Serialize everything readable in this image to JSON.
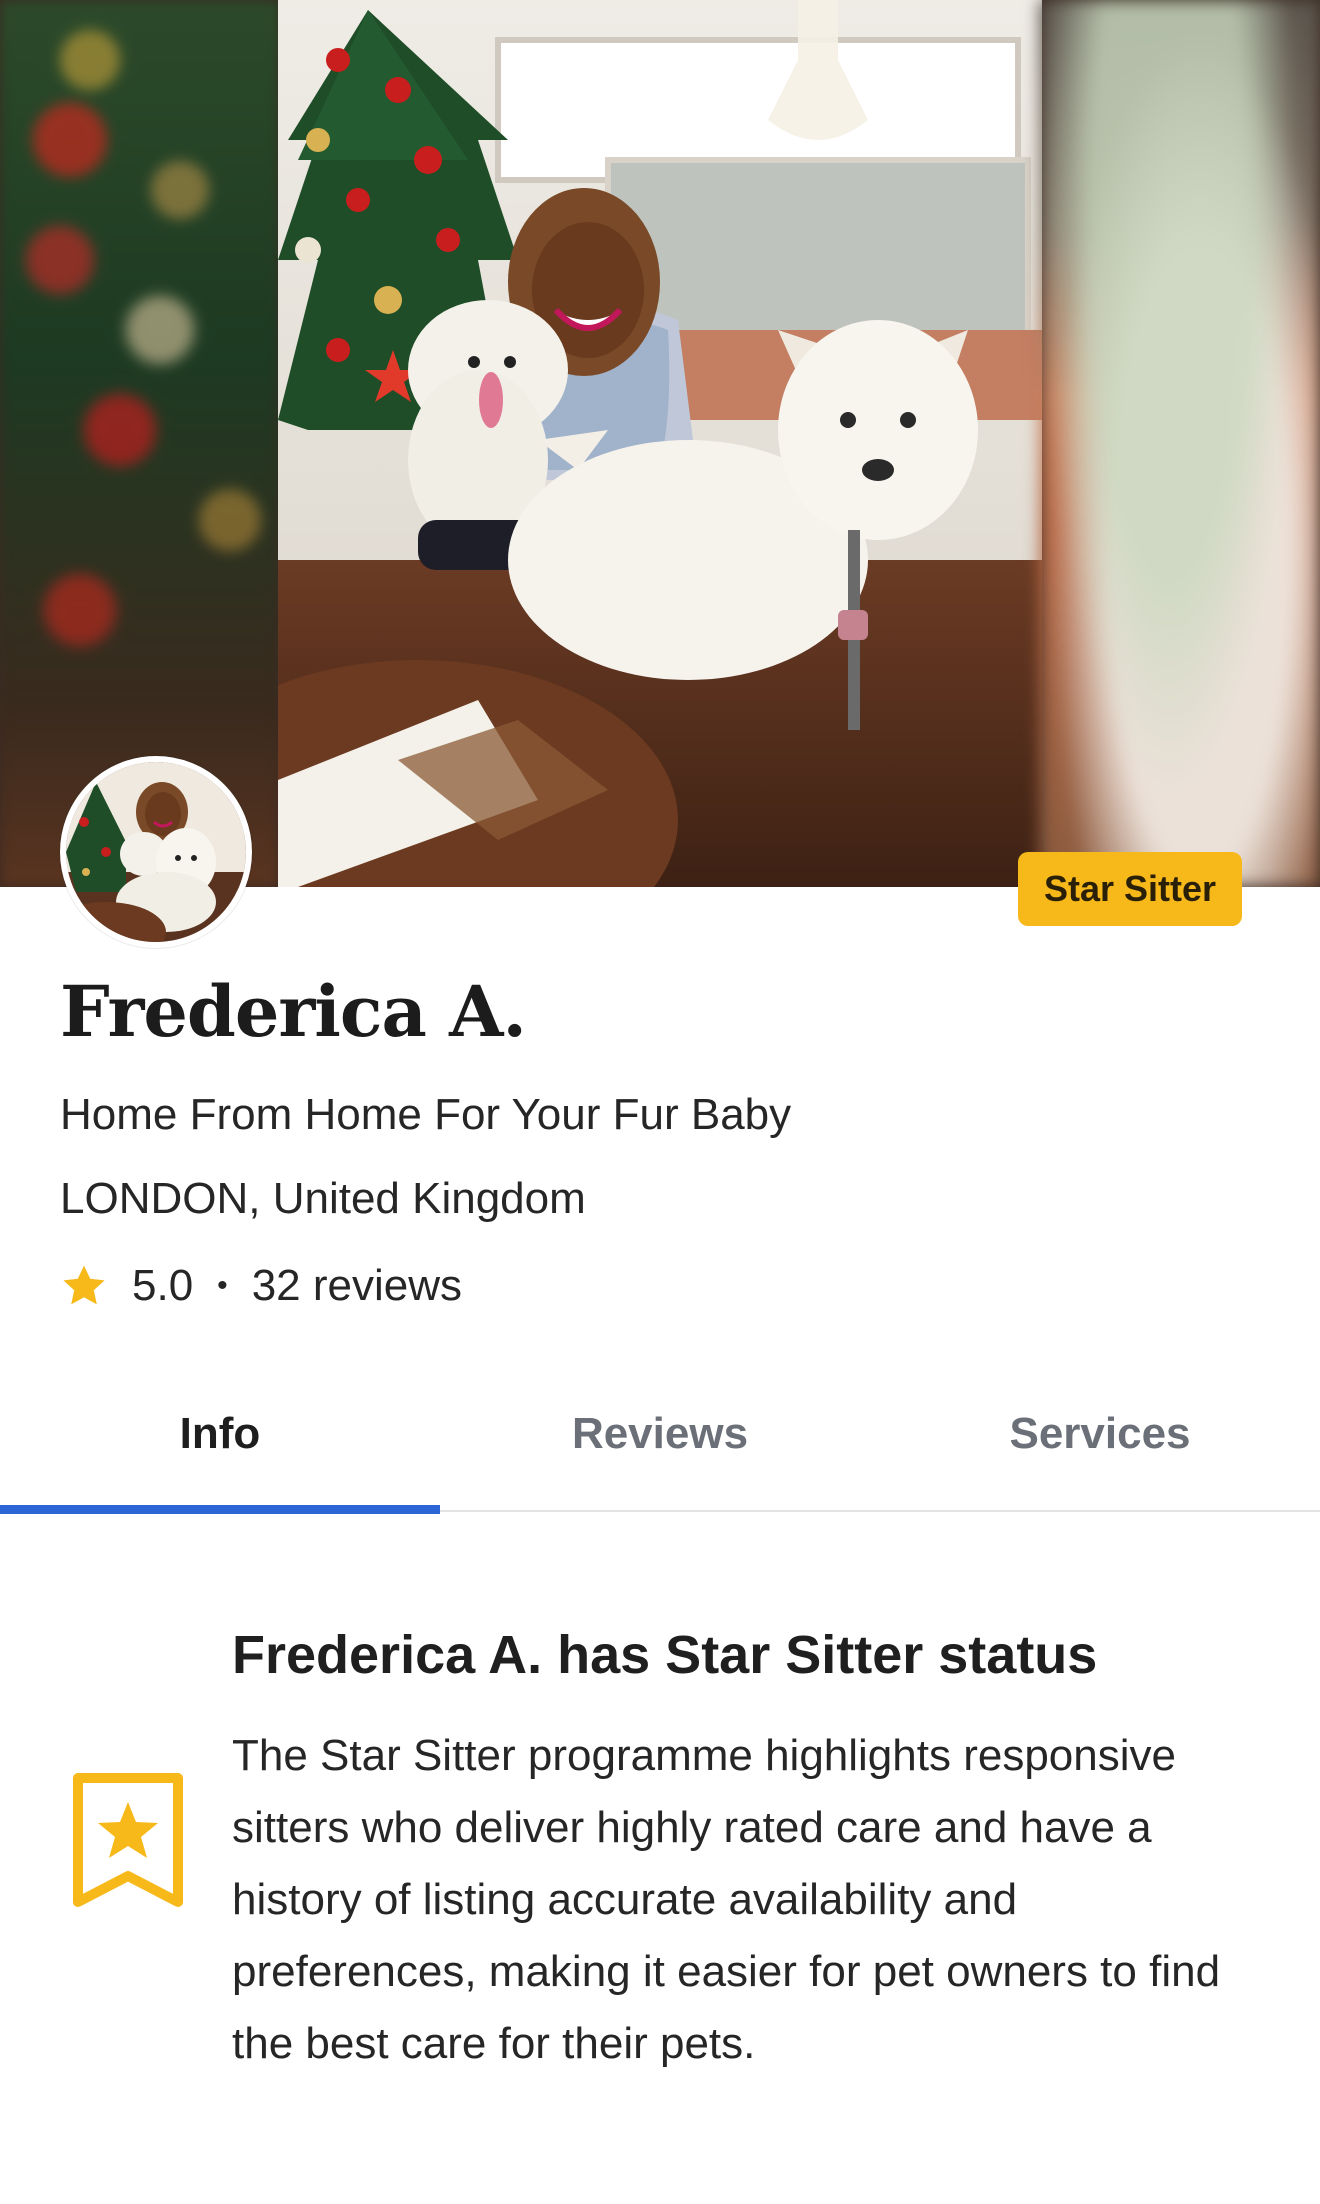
{
  "hero": {
    "badge_label": "Star Sitter"
  },
  "profile": {
    "name": "Frederica A.",
    "tagline": "Home From Home For Your Fur Baby",
    "location": "LONDON, United Kingdom",
    "rating": "5.0",
    "separator": "•",
    "reviews": "32 reviews",
    "star_color": "#f7b81a"
  },
  "tabs": [
    {
      "label": "Info",
      "active": true
    },
    {
      "label": "Reviews",
      "active": false
    },
    {
      "label": "Services",
      "active": false
    }
  ],
  "status_section": {
    "icon": "bookmark-star-icon",
    "title": "Frederica A. has Star Sitter status",
    "body": "The Star Sitter programme highlights responsive sitters who deliver highly rated care and have a history of listing accurate availability and preferences, making it easier for pet owners to find the best care for their pets."
  },
  "colors": {
    "accent_blue": "#2c66d6",
    "badge_yellow": "#f7b81a"
  }
}
